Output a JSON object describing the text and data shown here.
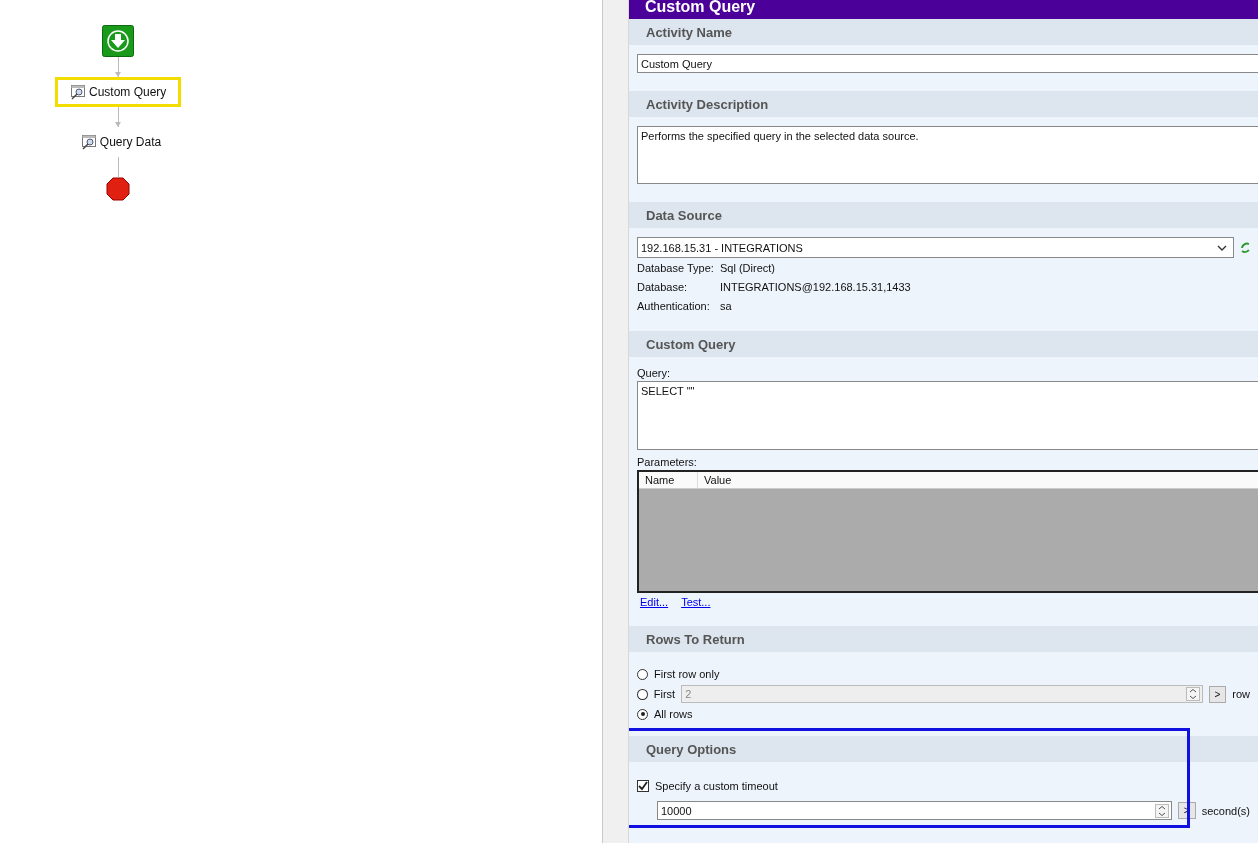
{
  "canvas": {
    "nodes": [
      {
        "kind": "start"
      },
      {
        "kind": "activity",
        "label": "Custom Query",
        "selected": true
      },
      {
        "kind": "activity",
        "label": "Query Data",
        "selected": false
      },
      {
        "kind": "stop"
      }
    ]
  },
  "panel": {
    "title": "Custom Query",
    "activity_name": {
      "heading": "Activity Name",
      "value": "Custom Query"
    },
    "activity_description": {
      "heading": "Activity Description",
      "value": "Performs the specified query in the selected data source."
    },
    "data_source": {
      "heading": "Data Source",
      "value": "192.168.15.31 - INTEGRATIONS",
      "details": [
        {
          "label": "Database Type:",
          "value": "Sql (Direct)"
        },
        {
          "label": "Database:",
          "value": "INTEGRATIONS@192.168.15.31,1433"
        },
        {
          "label": "Authentication:",
          "value": "sa"
        }
      ]
    },
    "custom_query": {
      "heading": "Custom Query",
      "query_label": "Query:",
      "query": "SELECT \"\"",
      "parameters_label": "Parameters:",
      "columns": [
        "Name",
        "Value"
      ],
      "links": [
        "Edit...",
        "Test..."
      ]
    },
    "rows_to_return": {
      "heading": "Rows To Return",
      "options": [
        {
          "kind": "plain",
          "label": "First row only",
          "selected": false
        },
        {
          "kind": "count",
          "label": "First",
          "selected": false,
          "value": "2",
          "disabled": true,
          "button": ">",
          "unit": "row"
        },
        {
          "kind": "plain",
          "label": "All rows",
          "selected": true
        }
      ]
    },
    "query_options": {
      "heading": "Query Options",
      "highlighted": true,
      "custom_timeout": {
        "label": "Specify a custom timeout",
        "checked": true,
        "value": "10000",
        "button": ">",
        "unit": "second(s)"
      }
    }
  }
}
